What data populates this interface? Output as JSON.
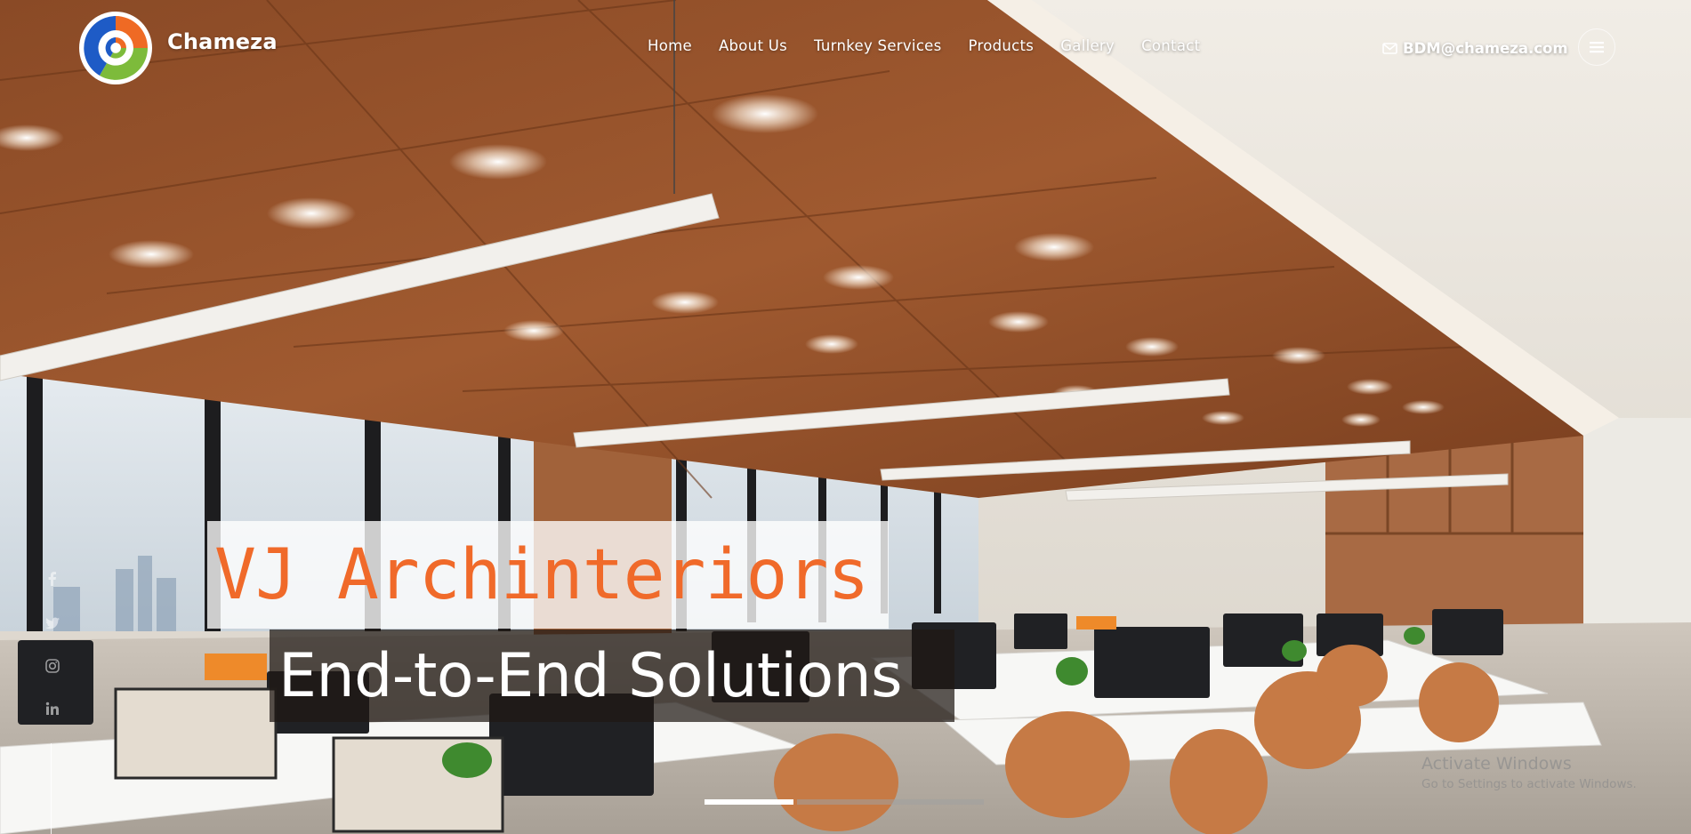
{
  "brand": {
    "name": "Chameza",
    "logo_icon": "chameza-swirl-logo",
    "colors": {
      "blue": "#1e5bc6",
      "orange": "#ef6a24",
      "green": "#7dbb3b"
    }
  },
  "nav": {
    "items": [
      {
        "label": "Home"
      },
      {
        "label": "About Us"
      },
      {
        "label": "Turnkey Services"
      },
      {
        "label": "Products"
      },
      {
        "label": "Gallery"
      },
      {
        "label": "Contact"
      }
    ]
  },
  "contact": {
    "email": "BDM@chameza.com",
    "email_icon": "envelope-icon"
  },
  "menu": {
    "icon": "hamburger-menu-icon"
  },
  "social": {
    "icons": [
      "facebook-icon",
      "twitter-icon",
      "instagram-icon",
      "linkedin-icon"
    ]
  },
  "hero": {
    "title": "VJ Archinteriors",
    "subtitle": "End-to-End Solutions",
    "title_color": "#f06a2a",
    "background": "office-interior-photo"
  },
  "slider": {
    "slides": 2,
    "active_index": 0
  },
  "watermark": {
    "line1": "Activate Windows",
    "line2": "Go to Settings to activate Windows."
  }
}
